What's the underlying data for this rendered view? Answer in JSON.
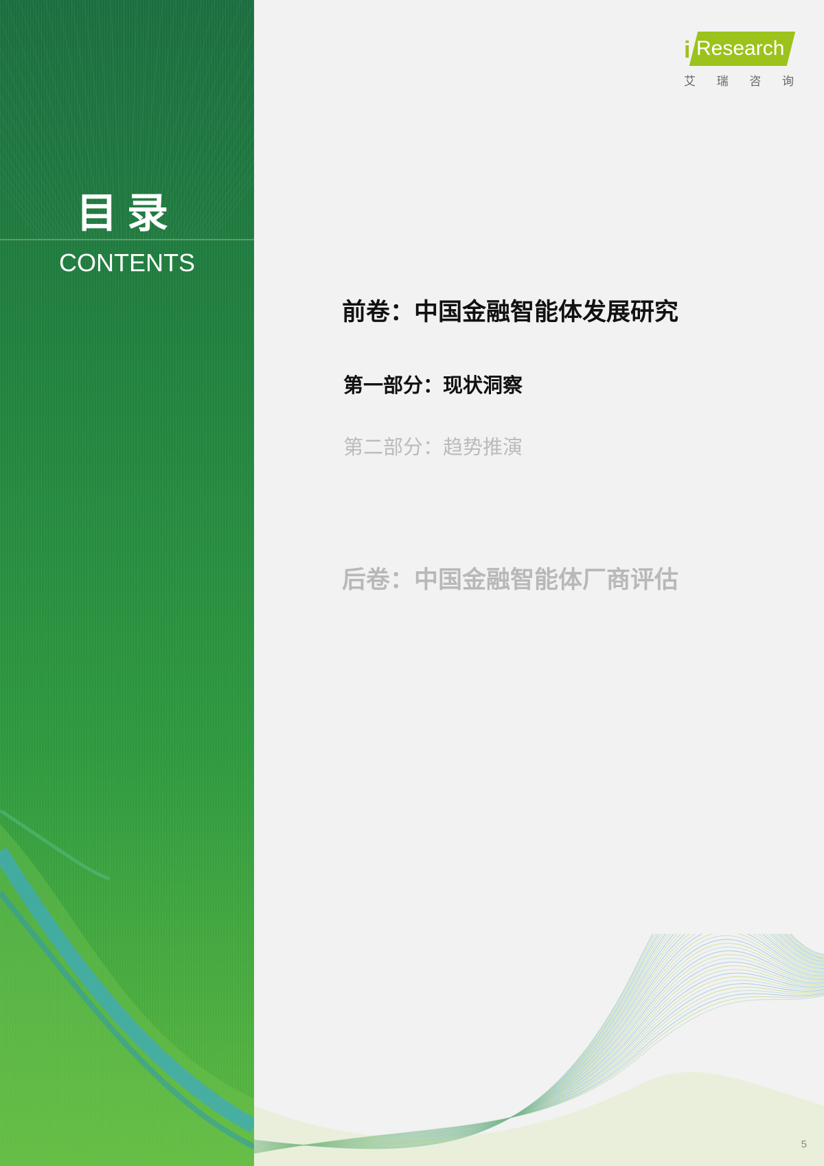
{
  "sidebar": {
    "title": "目录",
    "subtitle": "CONTENTS"
  },
  "logo": {
    "letter_i": "i",
    "brand": "Research",
    "cn_chars": [
      "艾",
      "瑞",
      "咨",
      "询"
    ],
    "color": "#9cc21c"
  },
  "toc": {
    "front_volume": "前卷：中国金融智能体发展研究",
    "part_one": "第一部分：现状洞察",
    "part_two": "第二部分：趋势推演",
    "back_volume": "后卷：中国金融智能体厂商评估"
  },
  "footer": {
    "page_number": "5"
  },
  "colors": {
    "sidebar_top": "#1b6e3f",
    "sidebar_bottom": "#5cb83f",
    "active_text": "#111111",
    "inactive_text": "#bbbbbb"
  }
}
